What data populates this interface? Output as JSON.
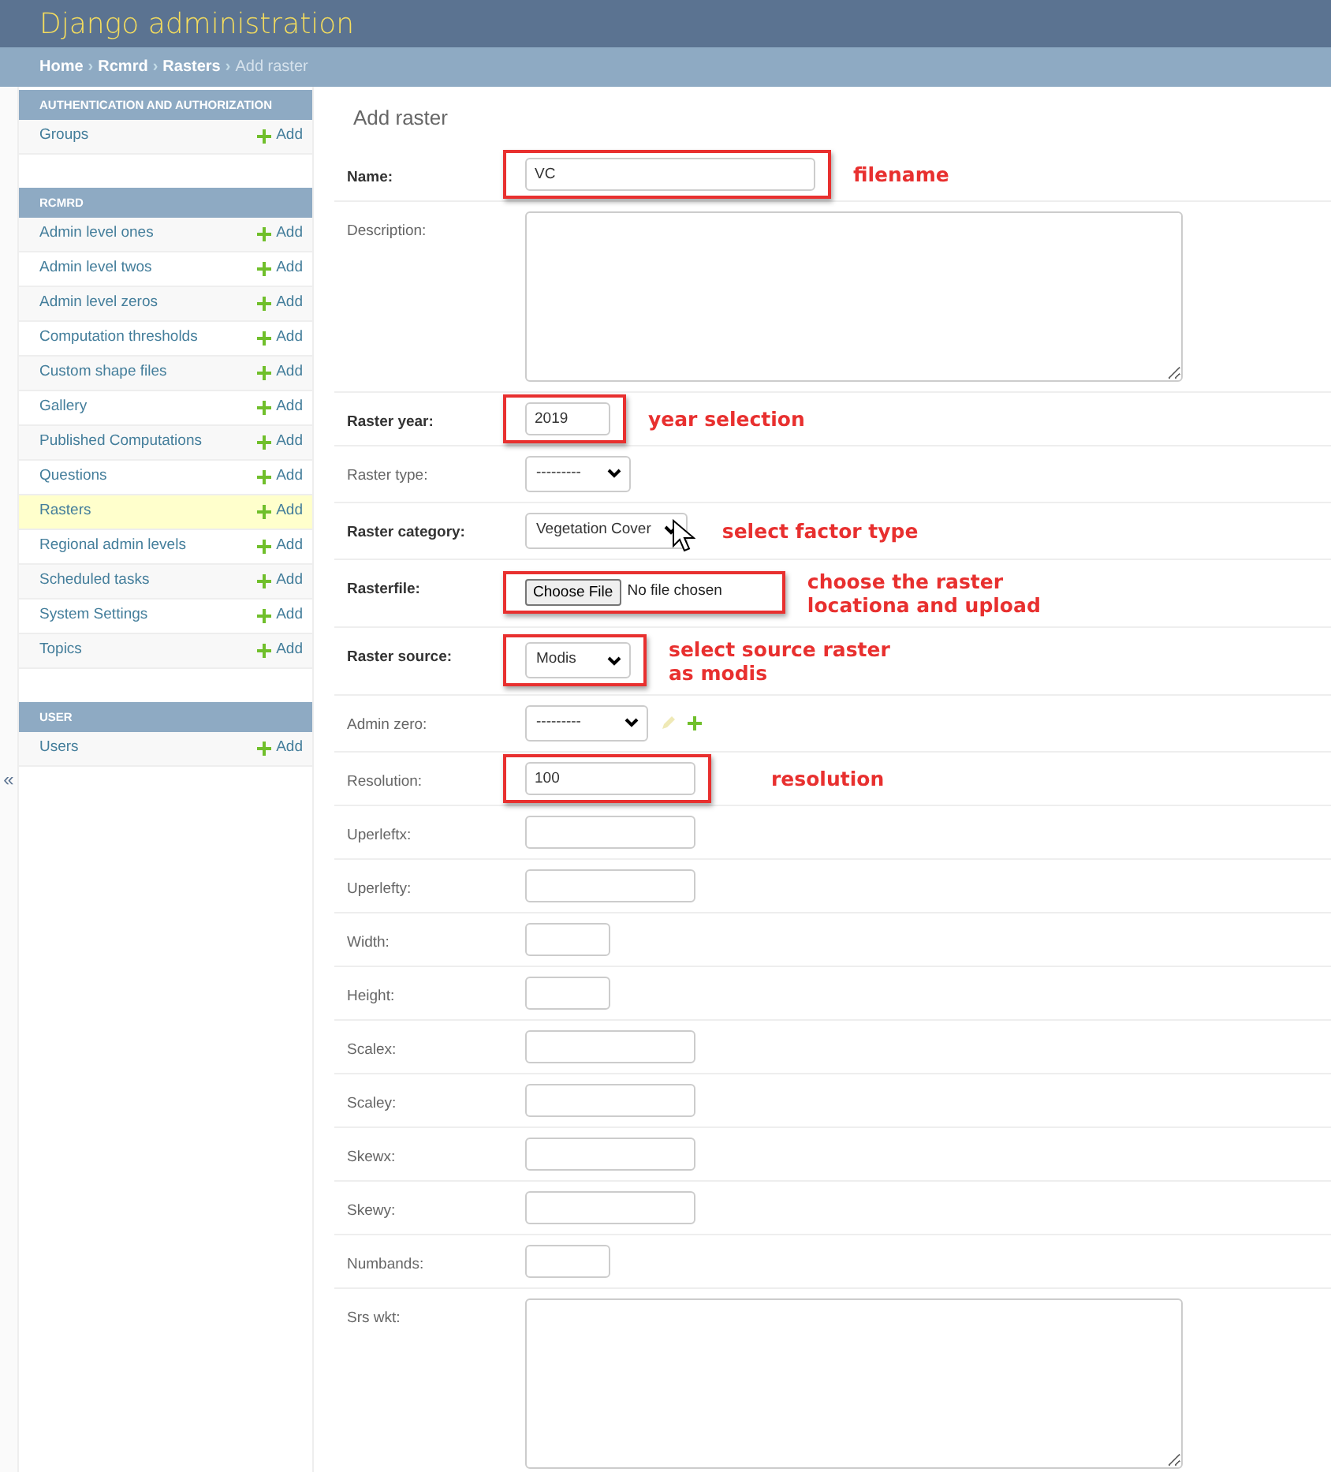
{
  "header": {
    "title": "Django administration"
  },
  "breadcrumbs": [
    {
      "label": "Home",
      "link": true
    },
    {
      "label": "Rcmrd",
      "link": true
    },
    {
      "label": "Rasters",
      "link": true
    },
    {
      "label": "Add raster",
      "link": false
    }
  ],
  "breadcrumb_separator": "›",
  "sidebar_toggle": "«",
  "sidebar": [
    {
      "caption": "AUTHENTICATION AND AUTHORIZATION",
      "models": [
        {
          "name": "Groups",
          "add": "Add",
          "selected": false
        }
      ]
    },
    {
      "caption": "RCMRD",
      "models": [
        {
          "name": "Admin level ones",
          "add": "Add",
          "selected": false
        },
        {
          "name": "Admin level twos",
          "add": "Add",
          "selected": false
        },
        {
          "name": "Admin level zeros",
          "add": "Add",
          "selected": false
        },
        {
          "name": "Computation thresholds",
          "add": "Add",
          "selected": false
        },
        {
          "name": "Custom shape files",
          "add": "Add",
          "selected": false
        },
        {
          "name": "Gallery",
          "add": "Add",
          "selected": false
        },
        {
          "name": "Published Computations",
          "add": "Add",
          "selected": false
        },
        {
          "name": "Questions",
          "add": "Add",
          "selected": false
        },
        {
          "name": "Rasters",
          "add": "Add",
          "selected": true
        },
        {
          "name": "Regional admin levels",
          "add": "Add",
          "selected": false
        },
        {
          "name": "Scheduled tasks",
          "add": "Add",
          "selected": false
        },
        {
          "name": "System Settings",
          "add": "Add",
          "selected": false
        },
        {
          "name": "Topics",
          "add": "Add",
          "selected": false
        }
      ]
    },
    {
      "caption": "USER",
      "models": [
        {
          "name": "Users",
          "add": "Add",
          "selected": false
        }
      ]
    }
  ],
  "page_title": "Add raster",
  "fields": [
    {
      "label": "Name:",
      "required": true,
      "kind": "text",
      "value": "VC",
      "highlighted": true,
      "annotation": "filename"
    },
    {
      "label": "Description:",
      "required": false,
      "kind": "textarea"
    },
    {
      "label": "Raster year:",
      "required": true,
      "kind": "short",
      "value": "2019",
      "highlighted": true,
      "annotation": "year selection"
    },
    {
      "label": "Raster type:",
      "required": false,
      "kind": "select",
      "value": "---------",
      "highlighted": false
    },
    {
      "label": "Raster category:",
      "required": true,
      "kind": "select",
      "value": "Vegetation Cover",
      "highlighted": false,
      "cursor": true,
      "annotation": "select factor type"
    },
    {
      "label": "Rasterfile:",
      "required": true,
      "kind": "file",
      "button": "Choose File",
      "value": "No file chosen",
      "highlighted": true,
      "annotation": "choose the raster locationa and upload"
    },
    {
      "label": "Raster source:",
      "required": true,
      "kind": "select",
      "value": "Modis",
      "highlighted": true,
      "annotation": "select source raster as modis"
    },
    {
      "label": "Admin zero:",
      "required": false,
      "kind": "select",
      "value": "---------",
      "related_actions": true,
      "highlighted": false
    },
    {
      "label": "Resolution:",
      "required": false,
      "kind": "number",
      "value": "100",
      "highlighted": true,
      "annotation": "resolution"
    },
    {
      "label": "Uperleftx:",
      "required": false,
      "kind": "number"
    },
    {
      "label": "Uperlefty:",
      "required": false,
      "kind": "number"
    },
    {
      "label": "Width:",
      "required": false,
      "kind": "short"
    },
    {
      "label": "Height:",
      "required": false,
      "kind": "short"
    },
    {
      "label": "Scalex:",
      "required": false,
      "kind": "number"
    },
    {
      "label": "Scaley:",
      "required": false,
      "kind": "number"
    },
    {
      "label": "Skewx:",
      "required": false,
      "kind": "number"
    },
    {
      "label": "Skewy:",
      "required": false,
      "kind": "number"
    },
    {
      "label": "Numbands:",
      "required": false,
      "kind": "short"
    },
    {
      "label": "Srs wkt:",
      "required": false,
      "kind": "textarea"
    }
  ]
}
